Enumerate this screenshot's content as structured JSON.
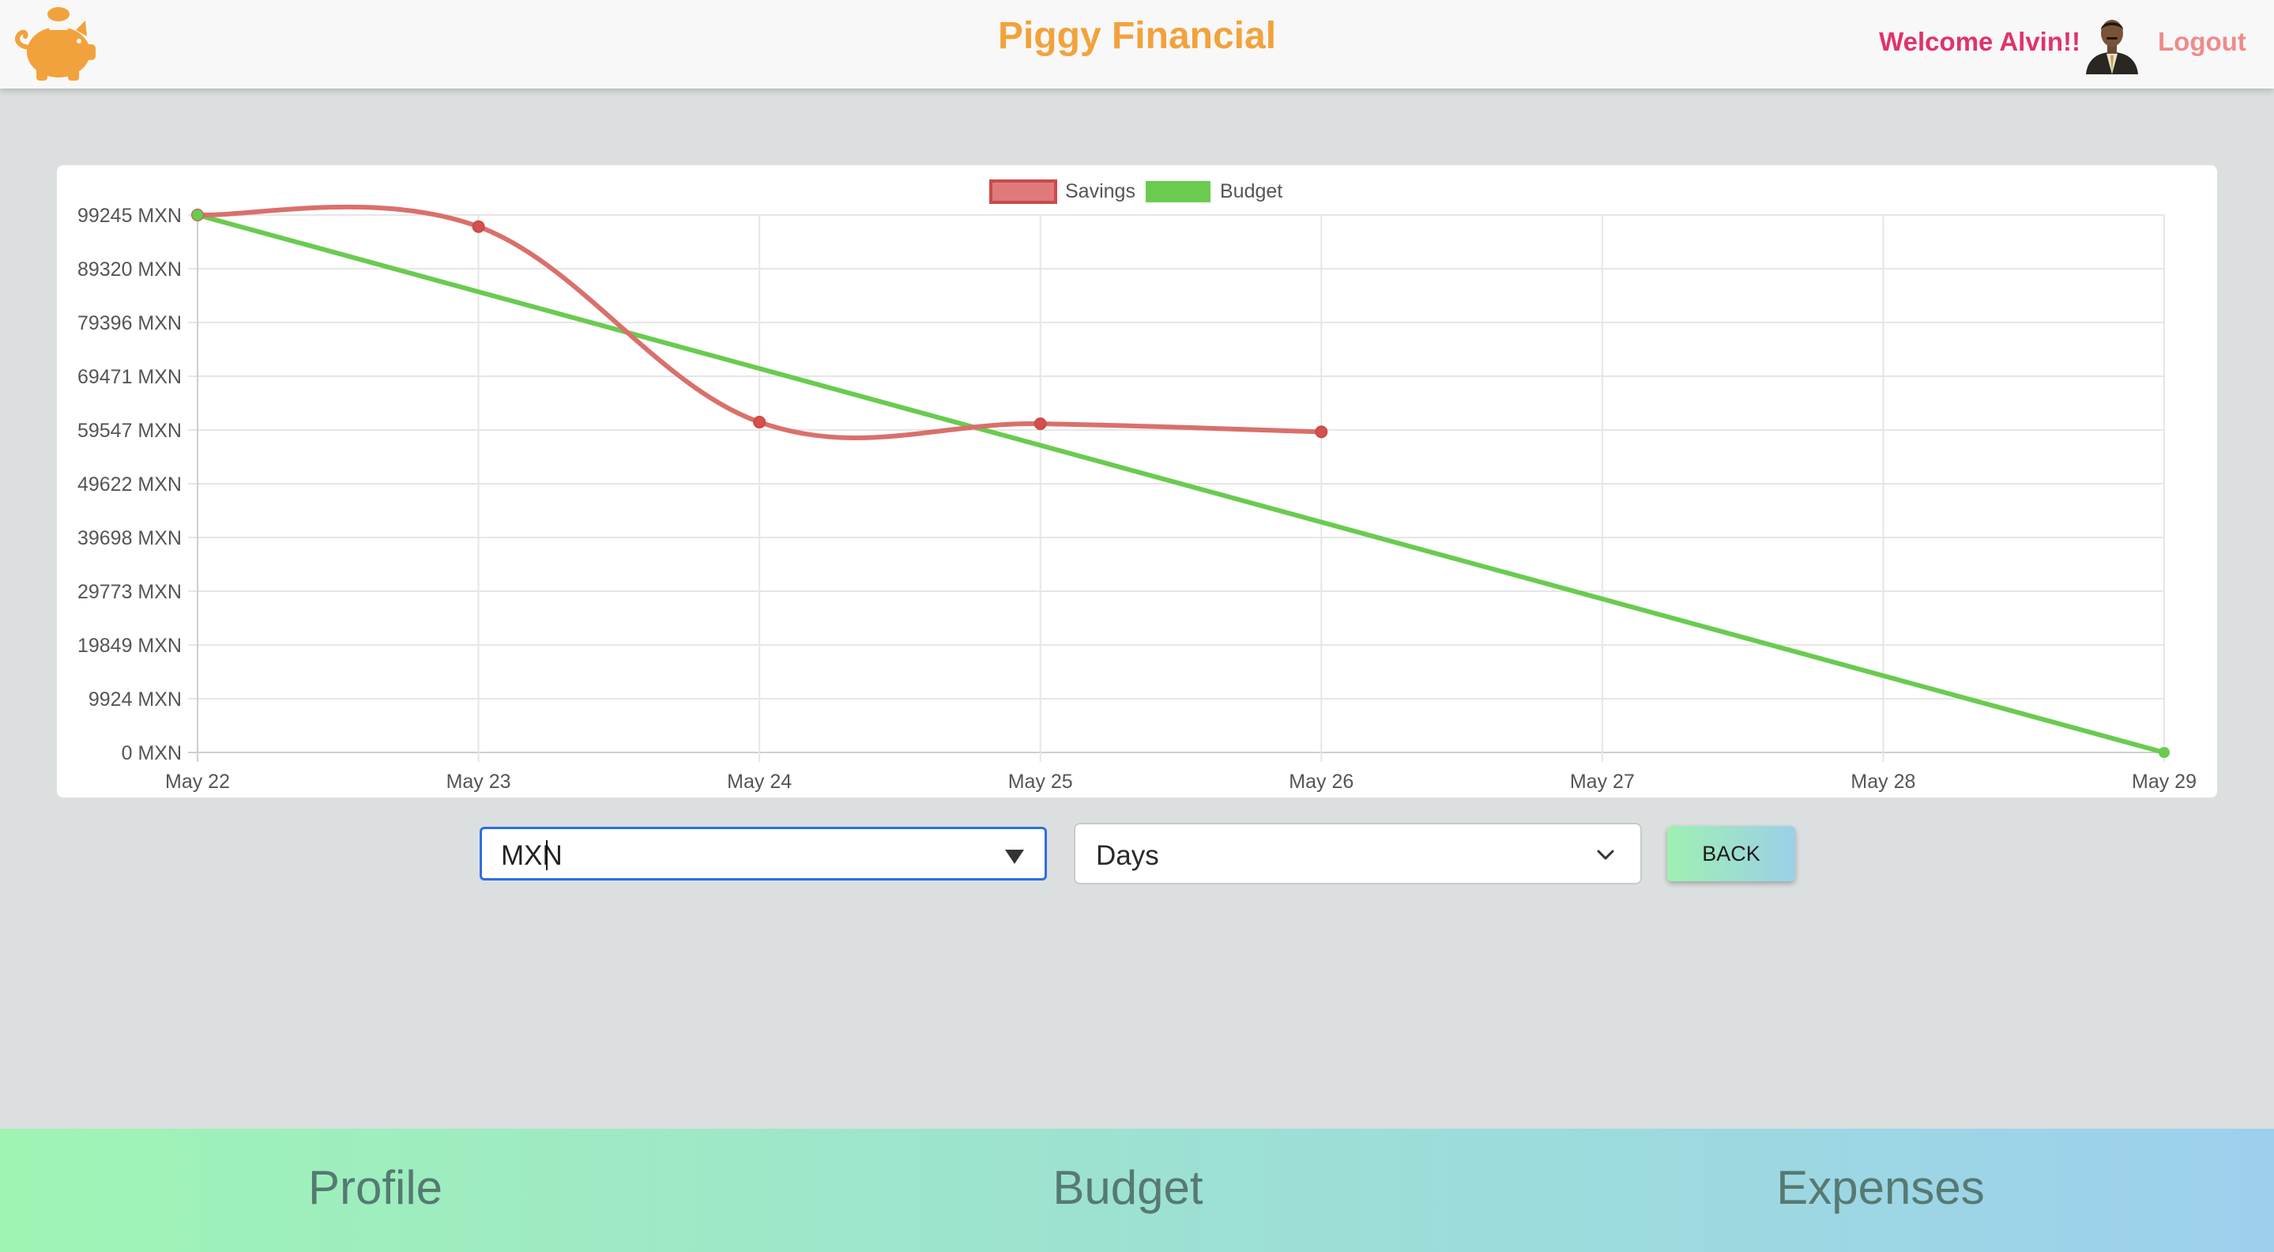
{
  "header": {
    "title": "Piggy Financial",
    "welcome_text": "Welcome Alvin!!",
    "logout_label": "Logout",
    "logo_icon": "piggy-bank-icon",
    "avatar_icon": "user-avatar"
  },
  "colors": {
    "title": "#f2a23c",
    "welcome": "#e0336a",
    "logout": "#f08a8a",
    "savings_line": "#d9706b",
    "savings_fill": "#e07a7a",
    "budget_line": "#6acb4f"
  },
  "chart_data": {
    "type": "line",
    "title": "",
    "xlabel": "",
    "ylabel": "",
    "legend_position": "top-center",
    "grid": true,
    "categories": [
      "May 22",
      "May 23",
      "May 24",
      "May 25",
      "May 26",
      "May 27",
      "May 28",
      "May 29"
    ],
    "y_ticks": [
      "0 MXN",
      "9924 MXN",
      "19849 MXN",
      "29773 MXN",
      "39698 MXN",
      "49622 MXN",
      "59547 MXN",
      "69471 MXN",
      "79396 MXN",
      "89320 MXN",
      "99245 MXN"
    ],
    "ylim": [
      0,
      99245
    ],
    "series": [
      {
        "name": "Savings",
        "values": [
          99245,
          97100,
          61000,
          60700,
          59200,
          null,
          null,
          null
        ]
      },
      {
        "name": "Budget",
        "values": [
          99245,
          null,
          null,
          null,
          null,
          null,
          null,
          0
        ]
      }
    ]
  },
  "controls": {
    "currency_value": "MXN",
    "period_value": "Days",
    "back_label": "BACK"
  },
  "nav": {
    "items": [
      "Profile",
      "Budget",
      "Expenses"
    ]
  }
}
